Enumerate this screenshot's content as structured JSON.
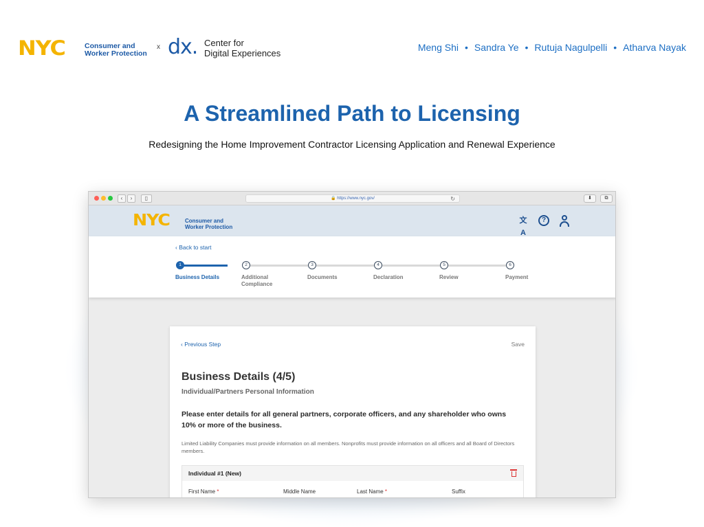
{
  "header": {
    "nyc_logo": "NYC",
    "brand_line1": "Consumer and",
    "brand_line2": "Worker Protection",
    "separator": "x",
    "dx_logo": "dx.",
    "dx_line1": "Center for",
    "dx_line2": "Digital Experiences",
    "authors": [
      "Meng Shi",
      "Sandra Ye",
      "Rutuja Nagulpelli",
      "Atharva Nayak"
    ]
  },
  "hero": {
    "title": "A Streamlined Path to Licensing",
    "subtitle": "Redesigning the Home Improvement Contractor Licensing Application and Renewal Experience"
  },
  "browser": {
    "url": "https://www.nyc.gov/",
    "download_symbol": "⬇",
    "window_symbol": "⧉"
  },
  "site": {
    "nyc_logo": "NYC",
    "brand_line1": "Consumer and",
    "brand_line2": "Worker Protection",
    "translate_icon": "文A",
    "help_icon": "?",
    "back_link": "‹  Back to start",
    "steps": [
      {
        "number": "1",
        "label": "Business Details"
      },
      {
        "number": "2",
        "label": "Additional Compliance"
      },
      {
        "number": "3",
        "label": "Documents"
      },
      {
        "number": "4",
        "label": "Declaration"
      },
      {
        "number": "5",
        "label": "Review"
      },
      {
        "number": "6",
        "label": "Payment"
      }
    ],
    "current_step": 1
  },
  "form": {
    "previous_step": "‹  Previous Step",
    "save": "Save",
    "title": "Business Details (4/5)",
    "subtitle": "Individual/Partners Personal Information",
    "instructions": "Please enter details for all general partners, corporate officers, and any shareholder who owns 10% or more of the business.",
    "note": "Limited Liability Companies must provide information on all members. Nonprofits must provide information on all officers and all Board of Directors members.",
    "individual_title": "Individual #1 (New)",
    "fields": {
      "first_name": "First Name",
      "middle_name": "Middle Name",
      "last_name": "Last Name",
      "suffix": "Suffix",
      "required_mark": "*"
    }
  },
  "colors": {
    "brand_blue": "#1d63ad",
    "nyc_yellow": "#f4b400",
    "danger_red": "#d33333"
  }
}
